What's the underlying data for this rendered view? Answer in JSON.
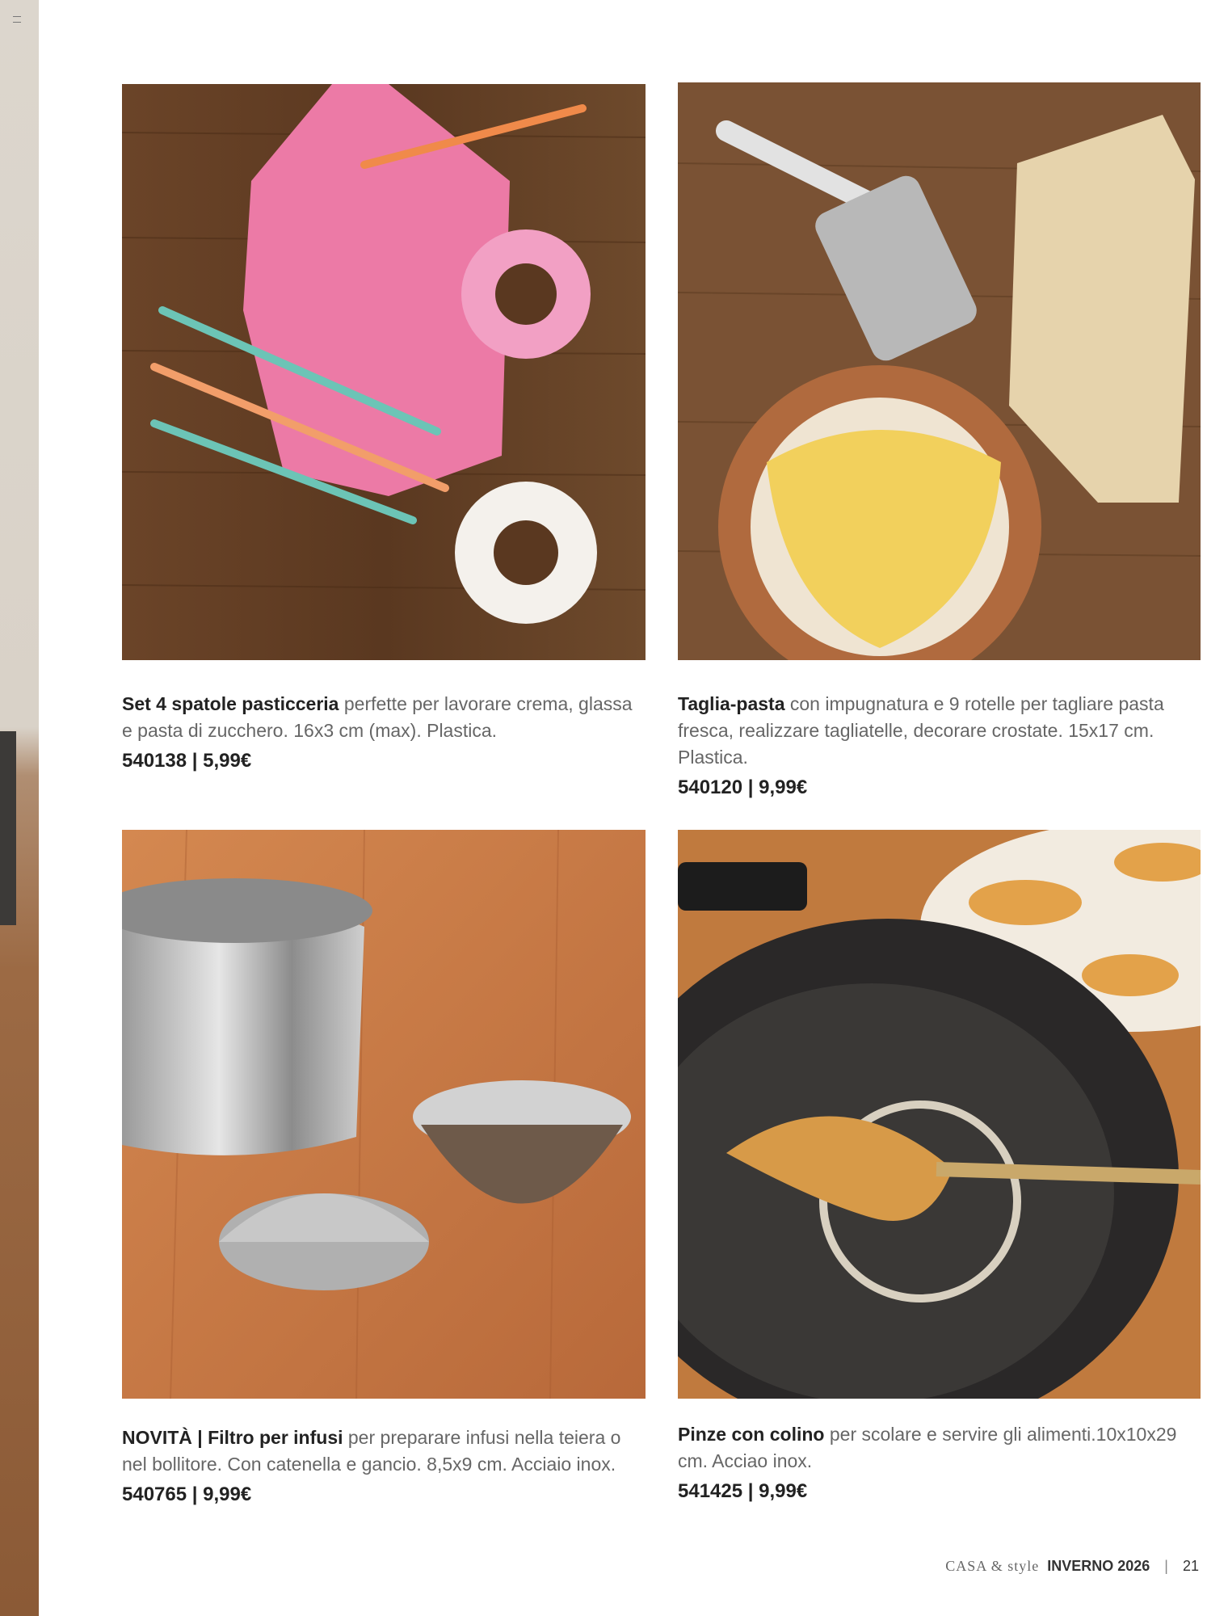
{
  "products": [
    {
      "title": "Set 4 spatole pasticceria",
      "description": " perfette per lavorare crema, glassa e pasta di zucchero. 16x3 cm (max). Plastica.",
      "price_line": "540138 | 5,99€",
      "image": "pastry-spatulas-photo"
    },
    {
      "title": "Taglia-pasta",
      "description": " con impugnatura e 9 rotelle per tagliare pasta fresca, realizzare tagliatelle, decorare crostate. 15x17 cm. Plastica.",
      "price_line": "540120 | 9,99€",
      "image": "pasta-cutter-photo"
    },
    {
      "title": "NOVITÀ | Filtro per infusi",
      "description": " per preparare infusi nella teiera o nel bollitore. Con catenella e gancio. 8,5x9 cm. Acciaio inox.",
      "price_line": "540765 | 9,99€",
      "image": "infuser-filter-photo"
    },
    {
      "title": "Pinze con colino",
      "description": " per scolare e servire gli alimenti.10x10x29 cm. Acciao inox.",
      "price_line": "541425 | 9,99€",
      "image": "strainer-tongs-photo"
    }
  ],
  "footer": {
    "brand": "CASA & style",
    "season": "INVERNO 2026",
    "separator": "|",
    "page_number": "21"
  }
}
